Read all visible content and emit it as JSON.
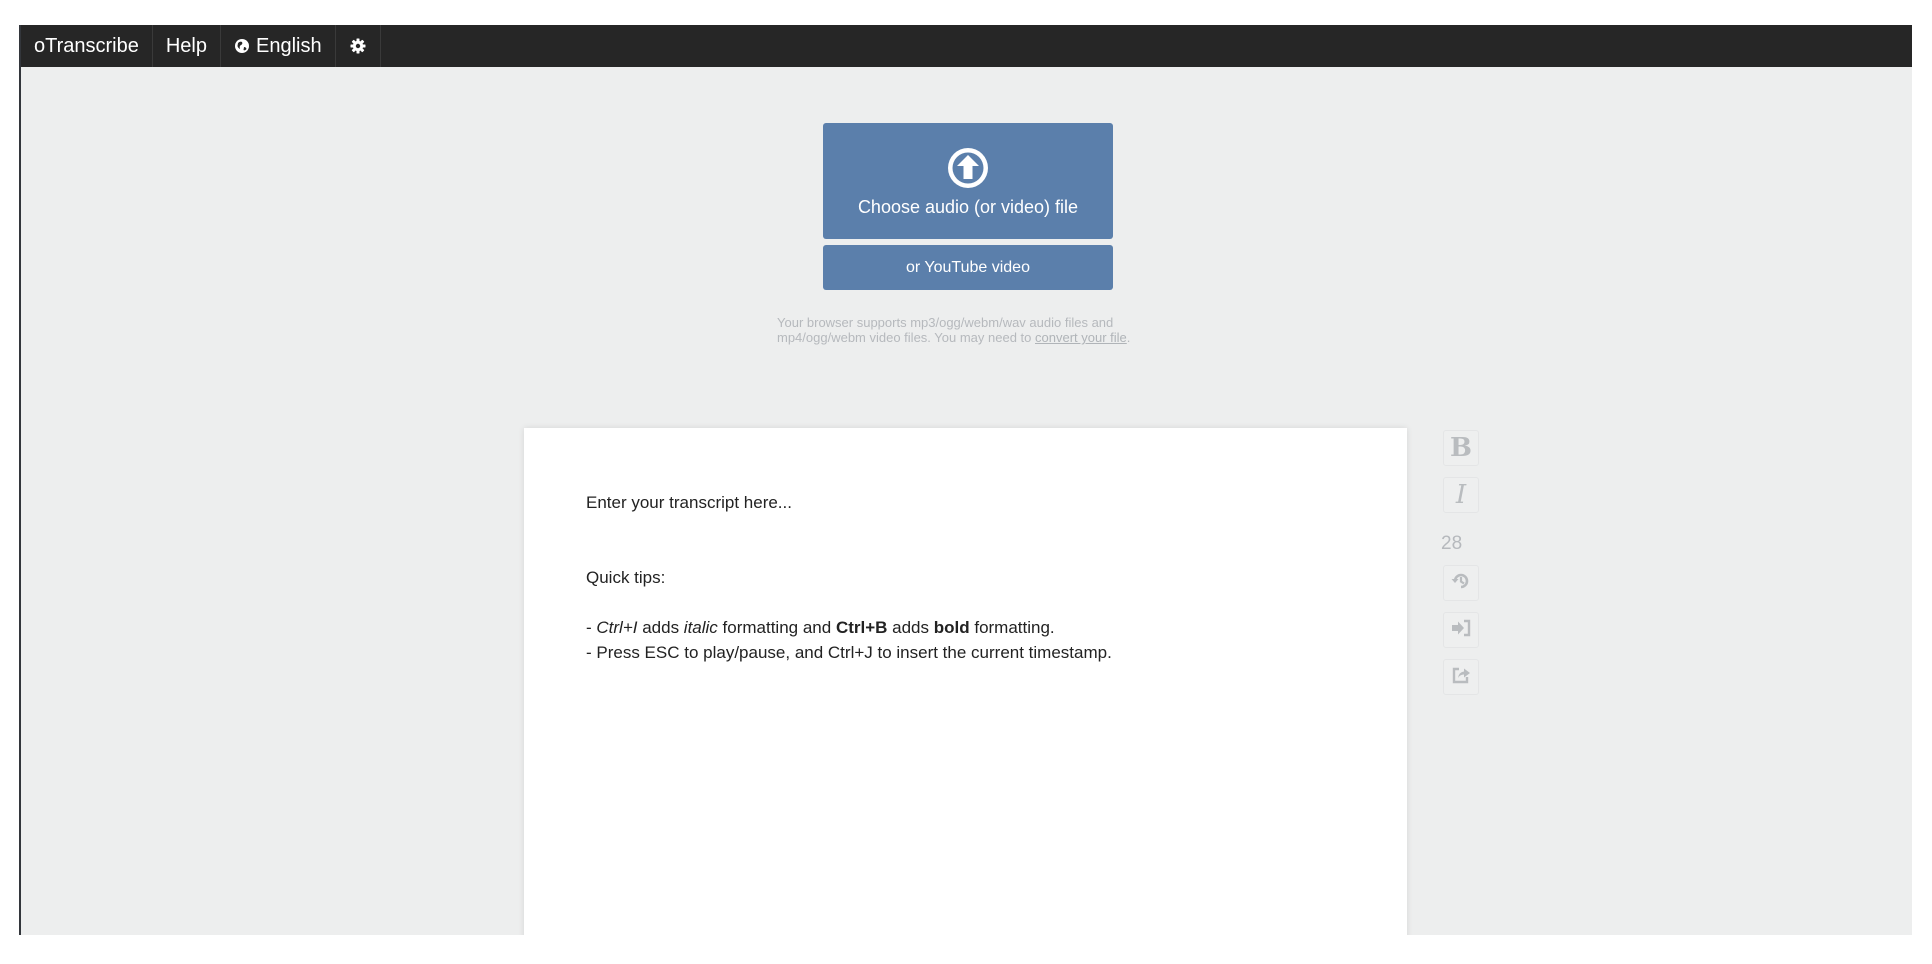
{
  "topbar": {
    "brand": "oTranscribe",
    "help": "Help",
    "language": "English",
    "icons": {
      "language": "globe-icon",
      "settings": "gear-icon"
    }
  },
  "upload": {
    "choose_label": "Choose audio (or video) file",
    "youtube_label": "or YouTube video",
    "support_text": "Your browser supports mp3/ogg/webm/wav audio files and mp4/ogg/webm video files. You may need to ",
    "convert_link": "convert your file",
    "support_end": ".",
    "icon": "upload-arrow-icon"
  },
  "editor": {
    "placeholder": "Enter your transcript here...",
    "tips_heading": "Quick tips:",
    "tip1": {
      "prefix": "- ",
      "shortcut_italic": "Ctrl+I",
      "adds1": " adds ",
      "italic_word": "italic",
      "mid": " formatting and ",
      "shortcut_bold": "Ctrl+B",
      "adds2": " adds ",
      "bold_word": "bold",
      "end": " formatting."
    },
    "tip2": "- Press ESC to play/pause, and Ctrl+J to insert the current timestamp."
  },
  "side_controls": {
    "bold": "B",
    "italic": "I",
    "speed": "28",
    "icons": {
      "bold": "bold-icon",
      "italic": "italic-icon",
      "history": "history-icon",
      "import": "import-icon",
      "export": "export-icon"
    }
  },
  "colors": {
    "topbar": "#262626",
    "button": "#5b7fab",
    "background": "#edeeee",
    "muted": "#b6b9bd"
  }
}
